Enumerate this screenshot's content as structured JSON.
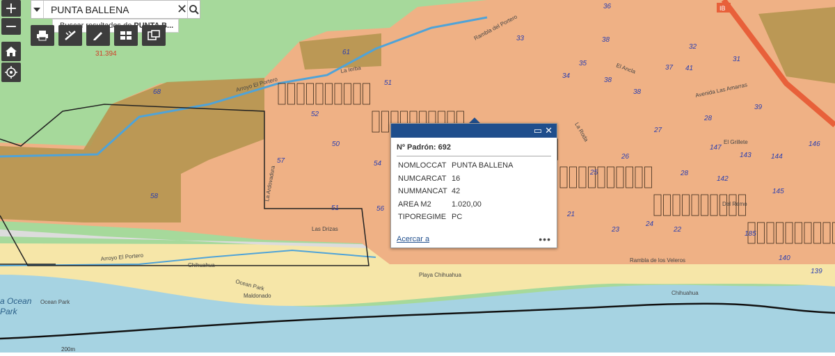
{
  "map": {
    "scale_label": "31.394",
    "scale_bar": "200m",
    "route_badge": "IB",
    "water_colors": {
      "sea": "#a6d3e2",
      "beach": "#f6e6a8",
      "green": "#a6d99b",
      "parcels": "#efb185",
      "reserve": "#b59650"
    },
    "parcel_labels": [
      {
        "text": "61"
      },
      {
        "text": "68"
      },
      {
        "text": "58"
      },
      {
        "text": "57"
      },
      {
        "text": "51"
      },
      {
        "text": "54"
      },
      {
        "text": "50"
      },
      {
        "text": "52"
      },
      {
        "text": "56"
      },
      {
        "text": "51"
      },
      {
        "text": "32"
      },
      {
        "text": "31"
      },
      {
        "text": "36"
      },
      {
        "text": "38"
      },
      {
        "text": "37"
      },
      {
        "text": "38"
      },
      {
        "text": "38"
      },
      {
        "text": "39"
      },
      {
        "text": "26"
      },
      {
        "text": "27"
      },
      {
        "text": "28"
      },
      {
        "text": "25"
      },
      {
        "text": "23"
      },
      {
        "text": "24"
      },
      {
        "text": "22"
      },
      {
        "text": "21"
      },
      {
        "text": "185"
      },
      {
        "text": "147"
      },
      {
        "text": "143"
      },
      {
        "text": "144"
      },
      {
        "text": "146"
      },
      {
        "text": "145"
      },
      {
        "text": "142"
      },
      {
        "text": "140"
      },
      {
        "text": "139"
      },
      {
        "text": "33"
      },
      {
        "text": "34"
      },
      {
        "text": "35"
      },
      {
        "text": "28"
      },
      {
        "text": "41"
      }
    ],
    "street_labels": [
      {
        "text": "Rambla del Portero"
      },
      {
        "text": "La Ierba"
      },
      {
        "text": "Arroyo El Portero"
      },
      {
        "text": "Arroyo El Portero"
      },
      {
        "text": "La Ardovadura"
      },
      {
        "text": "Las Drizas"
      },
      {
        "text": "Chihuahua"
      },
      {
        "text": "Ocean Park"
      },
      {
        "text": "Maldonado"
      },
      {
        "text": "Ocean Park"
      },
      {
        "text": "Playa Chihuahua"
      },
      {
        "text": "Chihuahua"
      },
      {
        "text": "El Grillete"
      },
      {
        "text": "Del Remo"
      },
      {
        "text": "Avenida Las Amarras"
      },
      {
        "text": "Rambla de los Veleros"
      },
      {
        "text": "El Ancla"
      },
      {
        "text": "La Roda"
      }
    ],
    "sea_labels": [
      {
        "text": "a Ocean"
      },
      {
        "text": "Park"
      }
    ]
  },
  "controls": {
    "zoom_in": "+",
    "zoom_out": "−"
  },
  "search": {
    "value": "PUNTA BALLENA",
    "suggestion_prefix": "Buscar resultados de ",
    "suggestion_term": "PUNTA B..."
  },
  "popup": {
    "title": "Nº Padrón: 692",
    "rows": [
      {
        "key": "NOMLOCCAT",
        "value": "PUNTA BALLENA"
      },
      {
        "key": "NUMCARCAT",
        "value": "16"
      },
      {
        "key": "NUMMANCAT",
        "value": "42"
      },
      {
        "key": "AREA M2",
        "value": "1.020,00"
      },
      {
        "key": "TIPOREGIME",
        "value": "PC"
      }
    ],
    "zoom_link": "Acercar a",
    "more": "•••",
    "maximize": "▭",
    "close": "✕"
  }
}
